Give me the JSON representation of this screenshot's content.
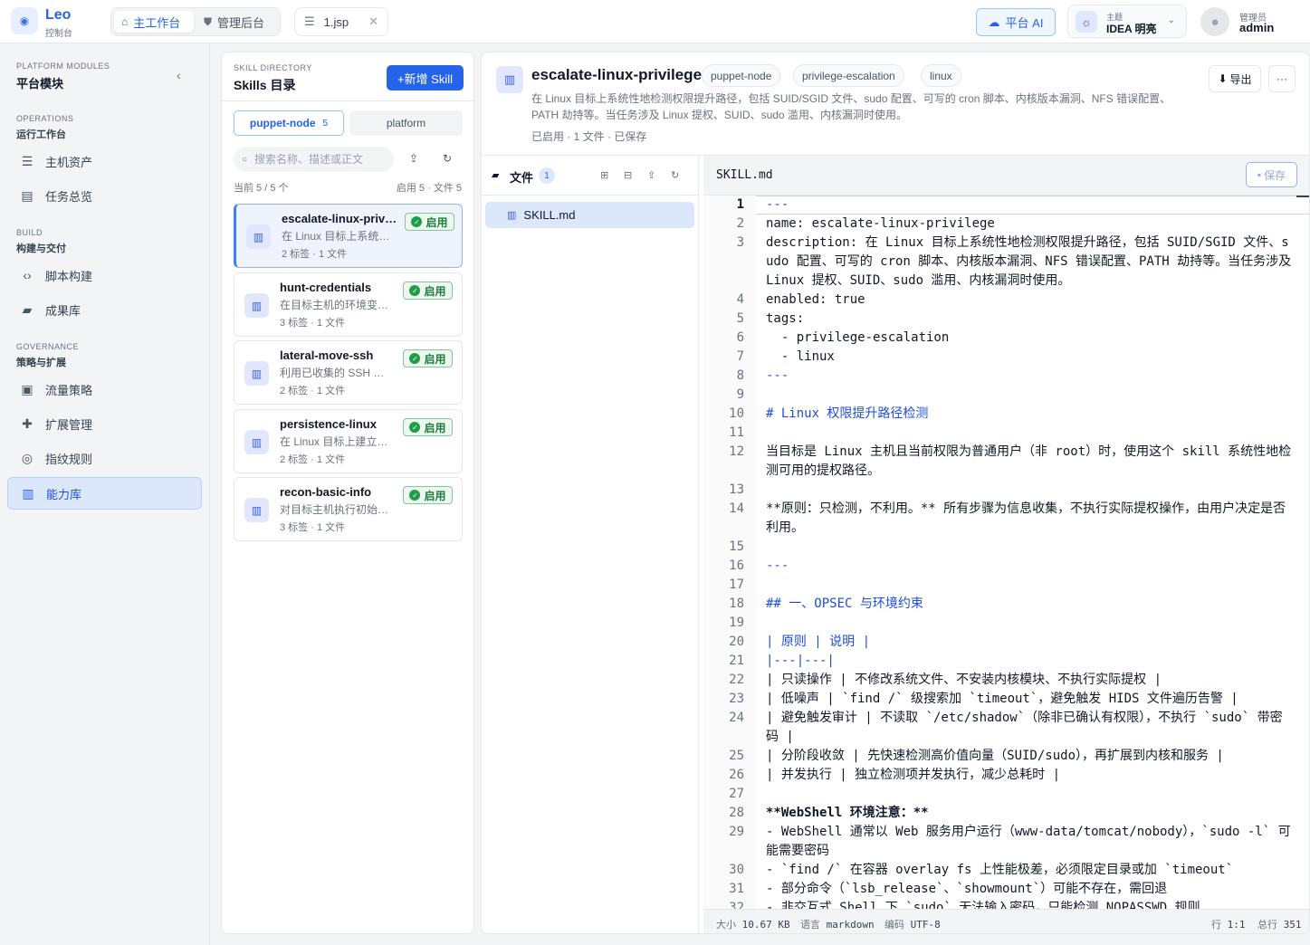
{
  "app": {
    "name": "Leo",
    "subtitle": "控制台"
  },
  "top_tabs": [
    {
      "label": "主工作台",
      "icon": "home-icon",
      "active": true
    },
    {
      "label": "管理后台",
      "icon": "shield-icon",
      "active": false
    }
  ],
  "open_file_tab": {
    "label": "1.jsp",
    "icon": "server-icon"
  },
  "ai_button": {
    "label": "平台 AI",
    "icon": "robot-icon"
  },
  "theme": {
    "label": "主题",
    "value": "IDEA 明亮",
    "icon": "sun-icon"
  },
  "user": {
    "role": "管理员",
    "name": "admin"
  },
  "nav": {
    "header_en": "PLATFORM MODULES",
    "header_zh": "平台模块",
    "groups": [
      {
        "en": "OPERATIONS",
        "zh": "运行工作台",
        "items": [
          {
            "label": "主机资产",
            "icon": "server-icon"
          },
          {
            "label": "任务总览",
            "icon": "clipboard-icon"
          }
        ]
      },
      {
        "en": "BUILD",
        "zh": "构建与交付",
        "items": [
          {
            "label": "脚本构建",
            "icon": "code-icon"
          },
          {
            "label": "成果库",
            "icon": "folder-icon"
          }
        ]
      },
      {
        "en": "GOVERNANCE",
        "zh": "策略与扩展",
        "items": [
          {
            "label": "流量策略",
            "icon": "traffic-icon"
          },
          {
            "label": "扩展管理",
            "icon": "puzzle-icon"
          },
          {
            "label": "指纹规则",
            "icon": "fingerprint-icon"
          },
          {
            "label": "能力库",
            "icon": "book-icon",
            "active": true
          }
        ]
      }
    ]
  },
  "skill_dir": {
    "header_en": "SKILL DIRECTORY",
    "header_zh": "Skills 目录",
    "new_button": "+新增 Skill",
    "tabs": [
      {
        "label": "puppet-node",
        "count": "5",
        "active": true
      },
      {
        "label": "platform",
        "active": false
      }
    ],
    "search_placeholder": "搜索名称、描述或正文",
    "count_left": "当前 5 / 5 个",
    "count_right": "启用 5 · 文件 5",
    "skills": [
      {
        "name": "escalate-linux-privilege",
        "desc": "在 Linux 目标上系统性地检测权限提升路径",
        "meta": "2 标签 · 1 文件",
        "status": "启用",
        "selected": true
      },
      {
        "name": "hunt-credentials",
        "desc": "在目标主机的环境变量与配置中搜寻凭据",
        "meta": "3 标签 · 1 文件",
        "status": "启用"
      },
      {
        "name": "lateral-move-ssh",
        "desc": "利用已收集的 SSH 私钥进行横向移动",
        "meta": "2 标签 · 1 文件",
        "status": "启用"
      },
      {
        "name": "persistence-linux",
        "desc": "在 Linux 目标上建立持久化",
        "meta": "2 标签 · 1 文件",
        "status": "启用"
      },
      {
        "name": "recon-basic-info",
        "desc": "对目标主机执行初始信息收集",
        "meta": "3 标签 · 1 文件",
        "status": "启用"
      }
    ]
  },
  "detail": {
    "title": "escalate-linux-privilege",
    "tags": [
      "puppet-node",
      "privilege-escalation",
      "linux"
    ],
    "description": "在 Linux 目标上系统性地检测权限提升路径，包括 SUID/SGID 文件、sudo 配置、可写的 cron 脚本、内核版本漏洞、NFS 错误配置、PATH 劫持等。当任务涉及 Linux 提权、SUID、sudo 滥用、内核漏洞时使用。",
    "meta": "已启用 · 1 文件 · 已保存",
    "export_label": "导出",
    "more_label": "···"
  },
  "files": {
    "title": "文件",
    "count": "1",
    "items": [
      {
        "name": "SKILL.md",
        "icon": "book-icon"
      }
    ]
  },
  "editor": {
    "filename": "SKILL.md",
    "save_label": "保存",
    "lines": [
      {
        "n": "1",
        "t": "---",
        "s": "fm"
      },
      {
        "n": "2",
        "t": "name: escalate-linux-privilege"
      },
      {
        "n": "3",
        "t": "description: 在 Linux 目标上系统性地检测权限提升路径，包括 SUID/SGID 文件、sudo 配置、可写的 cron 脚本、内核版本漏洞、NFS 错误配置、PATH 劫持等。当任务涉及 Linux 提权、SUID、sudo 滥用、内核漏洞时使用。"
      },
      {
        "n": "4",
        "t": "enabled: true"
      },
      {
        "n": "5",
        "t": "tags:"
      },
      {
        "n": "6",
        "t": "  - privilege-escalation"
      },
      {
        "n": "7",
        "t": "  - linux"
      },
      {
        "n": "8",
        "t": "---",
        "s": "fm"
      },
      {
        "n": "9",
        "t": ""
      },
      {
        "n": "10",
        "t": "# Linux 权限提升路径检测",
        "s": "hd"
      },
      {
        "n": "11",
        "t": ""
      },
      {
        "n": "12",
        "t": "当目标是 Linux 主机且当前权限为普通用户（非 root）时，使用这个 skill 系统性地检测可用的提权路径。"
      },
      {
        "n": "13",
        "t": ""
      },
      {
        "n": "14",
        "t": "**原则：只检测，不利用。** 所有步骤为信息收集，不执行实际提权操作，由用户决定是否利用。"
      },
      {
        "n": "15",
        "t": ""
      },
      {
        "n": "16",
        "t": "---",
        "s": "fm"
      },
      {
        "n": "17",
        "t": ""
      },
      {
        "n": "18",
        "t": "## 一、OPSEC 与环境约束",
        "s": "hd"
      },
      {
        "n": "19",
        "t": ""
      },
      {
        "n": "20",
        "t": "| 原则 | 说明 |",
        "s": "hd"
      },
      {
        "n": "21",
        "t": "|---|---|",
        "s": "hd"
      },
      {
        "n": "22",
        "t": "| 只读操作 | 不修改系统文件、不安装内核模块、不执行实际提权 |"
      },
      {
        "n": "23",
        "t": "| 低噪声 | `find /` 级搜索加 `timeout`，避免触发 HIDS 文件遍历告警 |"
      },
      {
        "n": "24",
        "t": "| 避免触发审计 | 不读取 `/etc/shadow`（除非已确认有权限），不执行 `sudo` 带密码 |"
      },
      {
        "n": "25",
        "t": "| 分阶段收敛 | 先快速检测高价值向量（SUID/sudo），再扩展到内核和服务 |"
      },
      {
        "n": "26",
        "t": "| 并发执行 | 独立检测项并发执行，减少总耗时 |"
      },
      {
        "n": "27",
        "t": ""
      },
      {
        "n": "28",
        "t": "**WebShell 环境注意：**",
        "s": "bold"
      },
      {
        "n": "29",
        "t": "- WebShell 通常以 Web 服务用户运行（www-data/tomcat/nobody），`sudo -l` 可能需要密码"
      },
      {
        "n": "30",
        "t": "- `find /` 在容器 overlay fs 上性能极差，必须限定目录或加 `timeout`"
      },
      {
        "n": "31",
        "t": "- 部分命令（`lsb_release`、`showmount`）可能不存在，需回退"
      },
      {
        "n": "32",
        "t": "- 非交互式 Shell 下 `sudo` 无法输入密码，只能检测 NOPASSWD 规则"
      }
    ],
    "status": {
      "size_label": "大小",
      "size": "10.67 KB",
      "lang_label": "语言",
      "lang": "markdown",
      "enc_label": "编码",
      "enc": "UTF-8",
      "pos_label": "行",
      "pos": "1:1",
      "total_label": "总行",
      "total": "351"
    }
  },
  "colors": {
    "accent": "#2563eb",
    "status_enabled": "#1e7e3e",
    "frontmatter": "#2f50c8",
    "heading": "#1d4ed8"
  }
}
